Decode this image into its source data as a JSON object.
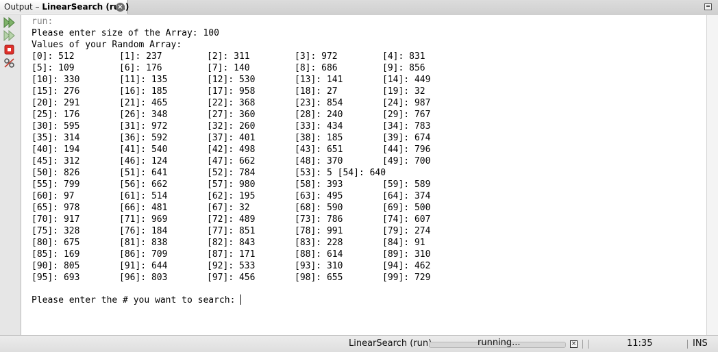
{
  "tab": {
    "prefix": "Output – ",
    "name": "LinearSearch (run)",
    "close": "×"
  },
  "console": {
    "run_label": "run:",
    "size_prompt": "Please enter size of the Array: 100",
    "values_label": "Values of your Random Array:",
    "rows": [
      [
        "[0]: 512",
        "[1]: 237",
        "[2]: 311",
        "[3]: 972",
        "[4]: 831"
      ],
      [
        "[5]: 109",
        "[6]: 176",
        "[7]: 140",
        "[8]: 686",
        "[9]: 856"
      ],
      [
        "[10]: 330",
        "[11]: 135",
        "[12]: 530",
        "[13]: 141",
        "[14]: 449"
      ],
      [
        "[15]: 276",
        "[16]: 185",
        "[17]: 958",
        "[18]: 27",
        "[19]: 32"
      ],
      [
        "[20]: 291",
        "[21]: 465",
        "[22]: 368",
        "[23]: 854",
        "[24]: 987"
      ],
      [
        "[25]: 176",
        "[26]: 348",
        "[27]: 360",
        "[28]: 240",
        "[29]: 767"
      ],
      [
        "[30]: 595",
        "[31]: 972",
        "[32]: 260",
        "[33]: 434",
        "[34]: 783"
      ],
      [
        "[35]: 314",
        "[36]: 592",
        "[37]: 401",
        "[38]: 185",
        "[39]: 674"
      ],
      [
        "[40]: 194",
        "[41]: 540",
        "[42]: 498",
        "[43]: 651",
        "[44]: 796"
      ],
      [
        "[45]: 312",
        "[46]: 124",
        "[47]: 662",
        "[48]: 370",
        "[49]: 700"
      ],
      [
        "[50]: 826",
        "[51]: 641",
        "[52]: 784",
        "[53]: 5 [54]: 640",
        ""
      ],
      [
        "[55]: 799",
        "[56]: 662",
        "[57]: 980",
        "[58]: 393",
        "[59]: 589"
      ],
      [
        "[60]: 97",
        "[61]: 514",
        "[62]: 195",
        "[63]: 495",
        "[64]: 374"
      ],
      [
        "[65]: 978",
        "[66]: 481",
        "[67]: 32",
        "[68]: 590",
        "[69]: 500"
      ],
      [
        "[70]: 917",
        "[71]: 969",
        "[72]: 489",
        "[73]: 786",
        "[74]: 607"
      ],
      [
        "[75]: 328",
        "[76]: 184",
        "[77]: 851",
        "[78]: 991",
        "[79]: 274"
      ],
      [
        "[80]: 675",
        "[81]: 838",
        "[82]: 843",
        "[83]: 228",
        "[84]: 91"
      ],
      [
        "[85]: 169",
        "[86]: 709",
        "[87]: 171",
        "[88]: 614",
        "[89]: 310"
      ],
      [
        "[90]: 805",
        "[91]: 644",
        "[92]: 533",
        "[93]: 310",
        "[94]: 462"
      ],
      [
        "[95]: 693",
        "[96]: 803",
        "[97]: 456",
        "[98]: 655",
        "[99]: 729"
      ]
    ],
    "search_prompt": "Please enter the # you want to search: "
  },
  "toolbar": {
    "buttons": [
      {
        "icon": "rerun-icon"
      },
      {
        "icon": "rerun-with-options-icon"
      },
      {
        "icon": "stop-icon"
      },
      {
        "icon": "settings-icon"
      }
    ]
  },
  "status": {
    "task": "LinearSearch (run)",
    "progress_text": "running...",
    "cancel": "×",
    "clock": "11:35",
    "mode": "INS"
  },
  "colors": {
    "stop_red": "#e0302a",
    "rerun_green": "#6aa84f"
  }
}
